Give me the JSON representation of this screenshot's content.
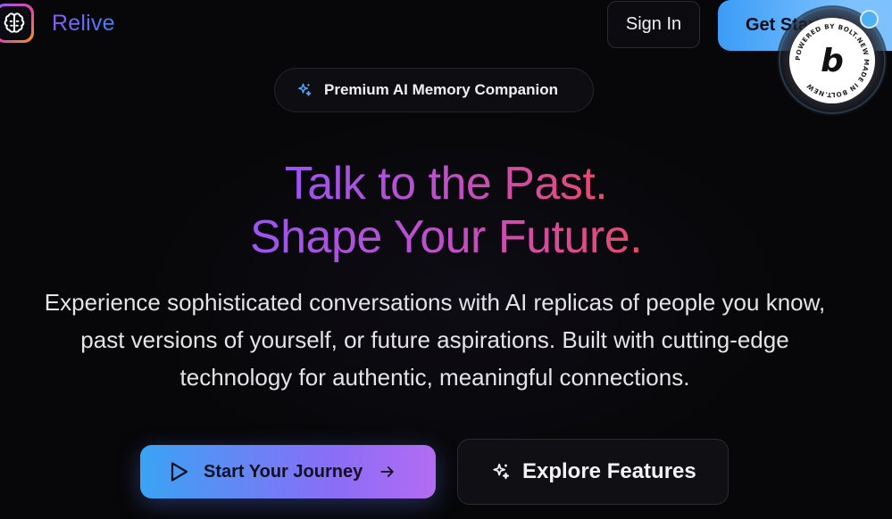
{
  "header": {
    "brand": "Relive",
    "signin_label": "Sign In",
    "get_started_label": "Get Started"
  },
  "pill": {
    "label": "Premium AI Memory Companion",
    "icon": "sparkle-icon"
  },
  "hero": {
    "headline_line1": "Talk to the Past.",
    "headline_line2": "Shape Your Future.",
    "description_lines": [
      "Experience sophisticated conversations with AI replicas of people you know,",
      "past versions of yourself, or future aspirations. Built with cutting-edge",
      "technology for authentic, meaningful connections."
    ]
  },
  "cta": {
    "primary_label": "Start Your Journey",
    "secondary_label": "Explore Features"
  },
  "badge": {
    "letter": "b",
    "ring_text": "POWERED BY BOLT.NEW MADE IN BOLT.NEW"
  },
  "colors": {
    "background": "#070709",
    "accent_blue": "#3b9cf6",
    "accent_purple": "#8b5cf6",
    "accent_pink": "#e84a6a"
  }
}
